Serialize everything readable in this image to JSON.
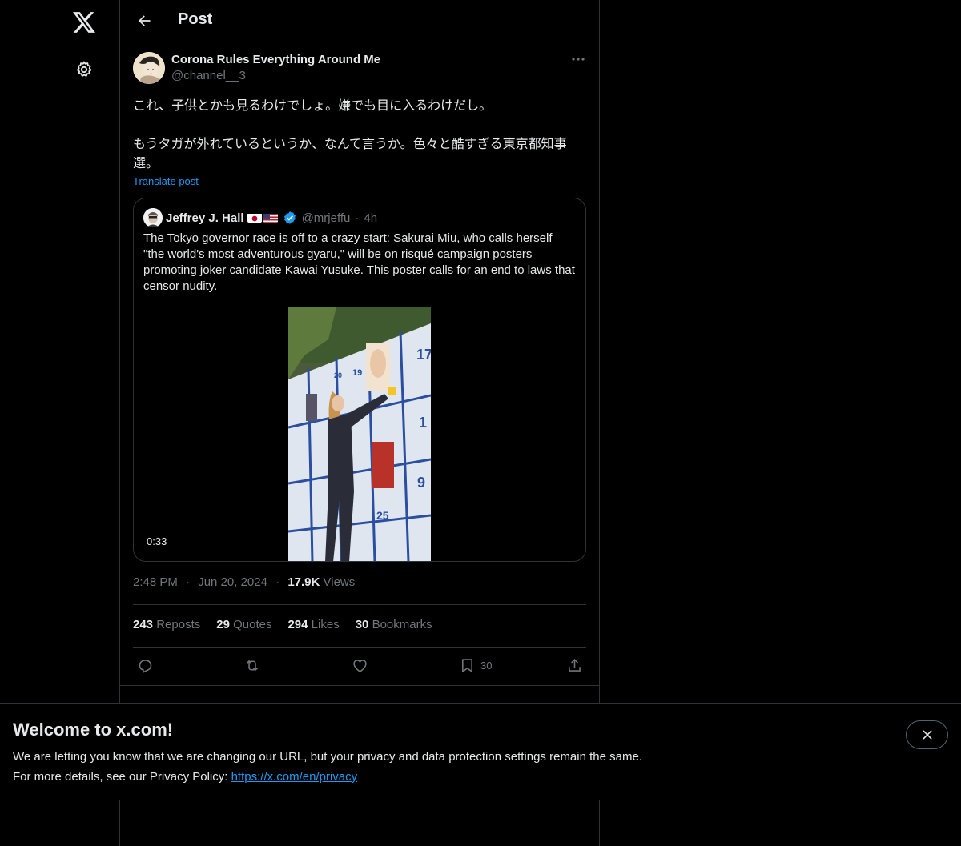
{
  "header": {
    "title": "Post"
  },
  "post": {
    "author_name": "Corona Rules Everything Around Me",
    "author_handle": "@channel__3",
    "text_line1": "これ、子供とかも見るわけでしょ。嫌でも目に入るわけだし。",
    "text_line2": "もうタガが外れているというか、なんて言うか。色々と酷すぎる東京都知事選。",
    "translate_label": "Translate post"
  },
  "quote": {
    "author_name": "Jeffrey J. Hall",
    "author_handle": "@mrjeffu",
    "separator": "·",
    "time": "4h",
    "text": "The Tokyo governor race is off to a crazy start: Sakurai Miu, who calls herself \"the world's most adventurous gyaru,\" will be on risqué campaign posters promoting joker candidate Kawai Yusuke. This poster calls for an end to laws that censor nudity.",
    "video_duration": "0:33"
  },
  "meta": {
    "time": "2:48 PM",
    "separator": "·",
    "date": "Jun 20, 2024",
    "views_count": "17.9K",
    "views_label": "Views"
  },
  "stats": {
    "reposts_count": "243",
    "reposts_label": "Reposts",
    "quotes_count": "29",
    "quotes_label": "Quotes",
    "likes_count": "294",
    "likes_label": "Likes",
    "bookmarks_count": "30",
    "bookmarks_label": "Bookmarks"
  },
  "actions": {
    "bookmark_count": "30"
  },
  "banner": {
    "title": "Welcome to x.com!",
    "line1": "We are letting you know that we are changing our URL, but your privacy and data protection settings remain the same.",
    "line2_prefix": "For more details, see our Privacy Policy: ",
    "link": "https://x.com/en/privacy"
  },
  "colors": {
    "accent": "#1d9bf0",
    "text": "#e7e9ea",
    "muted": "#71767b",
    "border": "#2f3336"
  },
  "icons": [
    "x-logo-icon",
    "gear-icon",
    "back-arrow-icon",
    "more-icon",
    "verified-icon",
    "reply-icon",
    "repost-icon",
    "like-icon",
    "bookmark-icon",
    "share-icon",
    "close-icon"
  ]
}
